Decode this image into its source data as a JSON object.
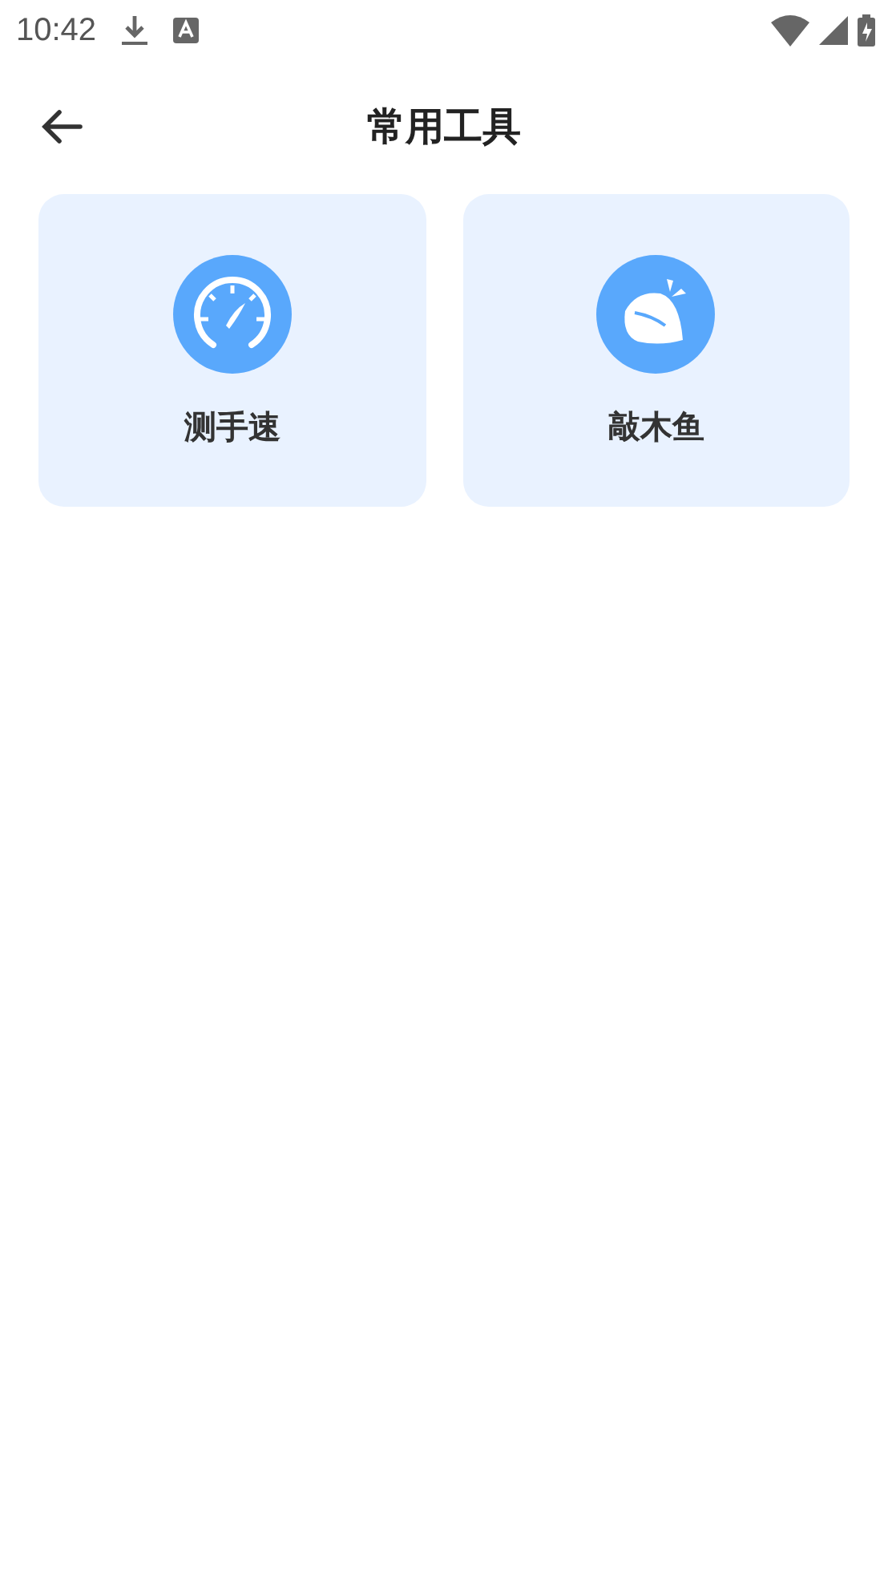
{
  "status_bar": {
    "time": "10:42"
  },
  "header": {
    "title": "常用工具"
  },
  "tools": [
    {
      "kind": "speedometer",
      "label": "测手速"
    },
    {
      "kind": "woodfish",
      "label": "敲木鱼"
    }
  ]
}
